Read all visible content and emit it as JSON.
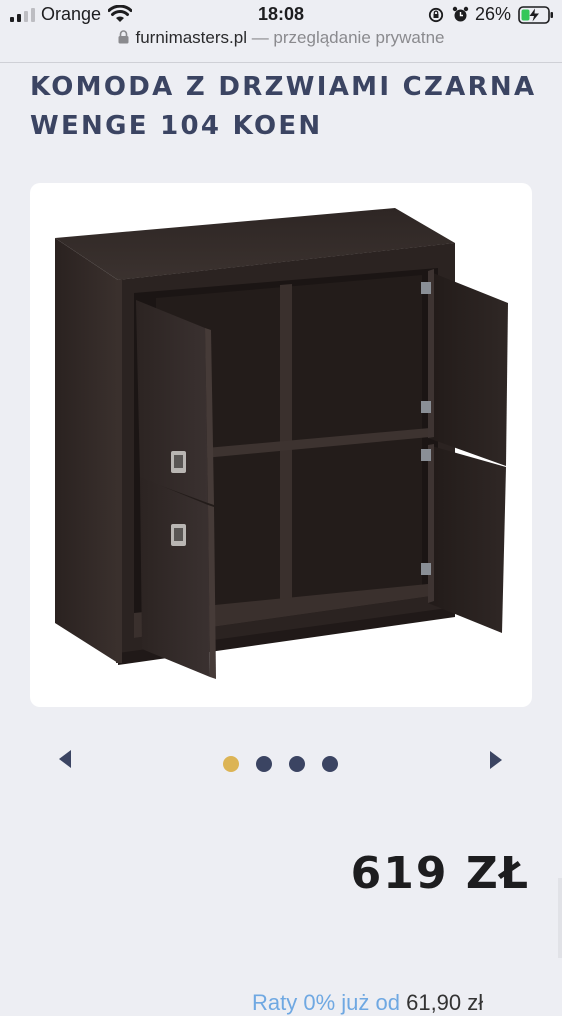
{
  "status_bar": {
    "carrier": "Orange",
    "time": "18:08",
    "battery_percent": "26%",
    "icons": [
      "signal-icon",
      "wifi-icon",
      "rotation-lock-icon",
      "alarm-icon",
      "battery-charging-icon"
    ]
  },
  "browser": {
    "domain": "furnimasters.pl",
    "mode_text": " — przeglądanie prywatne"
  },
  "product": {
    "title": "KOMODA Z DRZWIAMI CZARNA WENGE 104 KOEN",
    "price": "619 ZŁ",
    "installment": {
      "link_text": "Raty 0% już od",
      "amount": "61,90 zł"
    }
  },
  "carousel": {
    "slide_count": 4,
    "active_index": 0,
    "colors": {
      "active_dot": "#dcb455",
      "inactive_dot": "#3b4462",
      "arrow": "#3b4462"
    }
  },
  "colors": {
    "background": "#edeef3",
    "title": "#3b4462",
    "card": "#ffffff",
    "furniture": "#2a2220"
  }
}
